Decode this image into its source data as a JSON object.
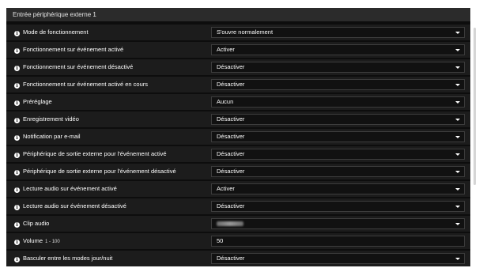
{
  "section": {
    "title": "Entrée périphérique externe 1"
  },
  "rows": [
    {
      "label": "Mode de fonctionnement",
      "value": "S'ouvre normalement",
      "type": "select"
    },
    {
      "label": "Fonctionnement sur événement activé",
      "value": "Activer",
      "type": "select"
    },
    {
      "label": "Fonctionnement sur événement désactivé",
      "value": "Désactiver",
      "type": "select"
    },
    {
      "label": "Fonctionnement sur événement activé en cours",
      "value": "Désactiver",
      "type": "select"
    },
    {
      "label": "Préréglage",
      "value": "Aucun",
      "type": "select"
    },
    {
      "label": "Enregistrement vidéo",
      "value": "Désactiver",
      "type": "select"
    },
    {
      "label": "Notification par e-mail",
      "value": "Désactiver",
      "type": "select"
    },
    {
      "label": "Périphérique de sortie externe pour l'événement activé",
      "value": "Désactiver",
      "type": "select"
    },
    {
      "label": "Périphérique de sortie externe pour l'événement désactivé",
      "value": "Désactiver",
      "type": "select"
    },
    {
      "label": "Lecture audio sur événement activé",
      "value": "Activer",
      "type": "select"
    },
    {
      "label": "Lecture audio sur événement désactivé",
      "value": "Désactiver",
      "type": "select"
    },
    {
      "label": "Clip audio",
      "value": "",
      "type": "select-blurred"
    },
    {
      "label": "Volume",
      "sublabel": "1 - 100",
      "value": "50",
      "type": "input"
    },
    {
      "label": "Basculer entre les modes jour/nuit",
      "value": "Désactiver",
      "type": "select"
    }
  ],
  "icons": {
    "info": "info-icon",
    "dropdown": "chevron-down-icon"
  },
  "info_glyph": "i",
  "colors": {
    "panel_bg": "#0d0d0d",
    "row_bg": "#1c1c1c",
    "header_bg": "#2b2b2b",
    "text": "#ffffff"
  }
}
